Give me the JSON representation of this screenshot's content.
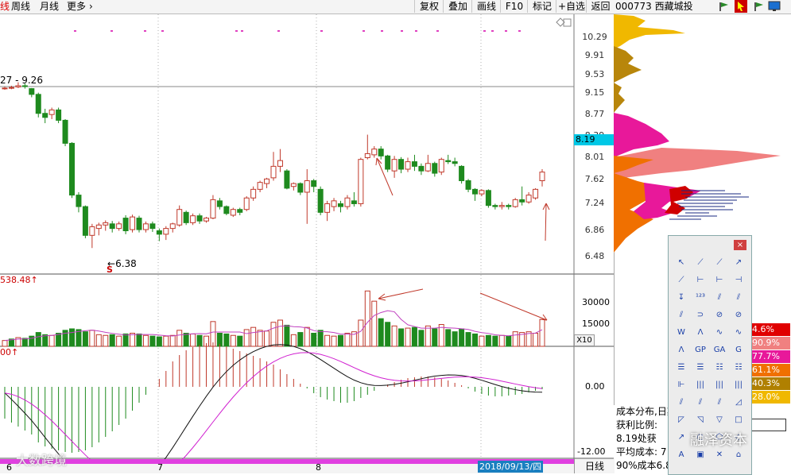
{
  "toolbar": {
    "edge": "线",
    "weekly": "周线",
    "monthly": "月线",
    "more": "更多",
    "more_arrow": "›",
    "buttons": [
      "复权",
      "叠加",
      "画线",
      "F10",
      "标记",
      "+自选",
      "返回"
    ]
  },
  "right_header": {
    "code_name": "000773 西藏城投"
  },
  "price_axis": [
    "10.29",
    "9.91",
    "9.53",
    "9.15",
    "8.77",
    "8.39",
    "8.01",
    "7.62",
    "7.24",
    "6.86",
    "6.48"
  ],
  "current_price": "8.19",
  "range_label": "27 - 9.26",
  "low_label": "6.38",
  "s_marker": "S",
  "volume_label": "538.48",
  "volume_axis": [
    "30000",
    "15000"
  ],
  "volume_unit": "X10",
  "macd_label": "00",
  "macd_axis": [
    "0.00",
    "-12.00"
  ],
  "x_labels": [
    "6",
    "7",
    "8"
  ],
  "date_highlight": "2018/09/13/四",
  "timeframe": "日线",
  "distribution": {
    "title": "成本分布,日期",
    "profit_ratio": "获利比例:",
    "cost_at": "8.19处获",
    "avg_cost": "平均成本: 7",
    "cost90": "90%成本6.8"
  },
  "percent_boxes": [
    {
      "text": "4.6%",
      "color": "#e00000"
    },
    {
      "text": "90.9%",
      "color": "#f08080"
    },
    {
      "text": "77.7%",
      "color": "#e8189a"
    },
    {
      "text": "61.1%",
      "color": "#f07000"
    },
    {
      "text": "40.3%",
      "color": "#b08000"
    },
    {
      "text": "28.0%",
      "color": "#f0b800"
    }
  ],
  "watermarks": {
    "left": "大数跨境",
    "right": "融泽资本"
  },
  "candles": [
    {
      "o": 9.15,
      "c": 9.16,
      "h": 9.18,
      "l": 9.13
    },
    {
      "o": 9.16,
      "c": 9.17,
      "h": 9.2,
      "l": 9.14
    },
    {
      "o": 9.18,
      "c": 9.2,
      "h": 9.26,
      "l": 9.16
    },
    {
      "o": 9.2,
      "c": 9.19,
      "h": 9.24,
      "l": 9.15
    },
    {
      "o": 9.15,
      "c": 9.05,
      "h": 9.16,
      "l": 9.0
    },
    {
      "o": 9.05,
      "c": 8.72,
      "h": 9.08,
      "l": 8.65
    },
    {
      "o": 8.72,
      "c": 8.65,
      "h": 8.8,
      "l": 8.55
    },
    {
      "o": 8.7,
      "c": 8.78,
      "h": 8.82,
      "l": 8.62
    },
    {
      "o": 8.78,
      "c": 8.6,
      "h": 8.82,
      "l": 8.55
    },
    {
      "o": 8.6,
      "c": 8.2,
      "h": 8.62,
      "l": 8.15
    },
    {
      "o": 8.2,
      "c": 7.3,
      "h": 8.22,
      "l": 7.25
    },
    {
      "o": 7.3,
      "c": 7.1,
      "h": 7.35,
      "l": 7.0
    },
    {
      "o": 7.1,
      "c": 6.6,
      "h": 7.12,
      "l": 6.55
    },
    {
      "o": 6.6,
      "c": 6.75,
      "h": 6.8,
      "l": 6.38
    },
    {
      "o": 6.72,
      "c": 6.78,
      "h": 6.82,
      "l": 6.6
    },
    {
      "o": 6.78,
      "c": 6.82,
      "h": 6.86,
      "l": 6.68
    },
    {
      "o": 6.8,
      "c": 6.72,
      "h": 6.85,
      "l": 6.65
    },
    {
      "o": 6.72,
      "c": 6.8,
      "h": 6.84,
      "l": 6.68
    },
    {
      "o": 6.9,
      "c": 6.68,
      "h": 6.95,
      "l": 6.62
    },
    {
      "o": 6.7,
      "c": 6.92,
      "h": 6.96,
      "l": 6.65
    },
    {
      "o": 6.9,
      "c": 6.7,
      "h": 6.94,
      "l": 6.65
    },
    {
      "o": 6.7,
      "c": 6.8,
      "h": 6.84,
      "l": 6.65
    },
    {
      "o": 6.8,
      "c": 6.72,
      "h": 6.84,
      "l": 6.66
    },
    {
      "o": 6.68,
      "c": 6.62,
      "h": 6.72,
      "l": 6.5
    },
    {
      "o": 6.62,
      "c": 6.72,
      "h": 6.76,
      "l": 6.52
    },
    {
      "o": 6.72,
      "c": 6.8,
      "h": 6.82,
      "l": 6.65
    },
    {
      "o": 6.78,
      "c": 7.05,
      "h": 7.12,
      "l": 6.75
    },
    {
      "o": 7.0,
      "c": 6.82,
      "h": 7.03,
      "l": 6.78
    },
    {
      "o": 6.82,
      "c": 6.94,
      "h": 6.98,
      "l": 6.78
    },
    {
      "o": 6.94,
      "c": 6.85,
      "h": 6.98,
      "l": 6.8
    },
    {
      "o": 6.85,
      "c": 6.9,
      "h": 6.92,
      "l": 6.82
    },
    {
      "o": 6.9,
      "c": 7.22,
      "h": 7.3,
      "l": 6.88
    },
    {
      "o": 7.2,
      "c": 7.1,
      "h": 7.25,
      "l": 7.05
    },
    {
      "o": 7.1,
      "c": 6.98,
      "h": 7.12,
      "l": 6.95
    },
    {
      "o": 6.95,
      "c": 7.05,
      "h": 7.08,
      "l": 6.92
    },
    {
      "o": 7.05,
      "c": 7.0,
      "h": 7.08,
      "l": 6.95
    },
    {
      "o": 7.05,
      "c": 7.25,
      "h": 7.28,
      "l": 7.02
    },
    {
      "o": 7.25,
      "c": 7.4,
      "h": 7.45,
      "l": 7.2
    },
    {
      "o": 7.4,
      "c": 7.52,
      "h": 7.55,
      "l": 7.35
    },
    {
      "o": 7.5,
      "c": 7.58,
      "h": 7.6,
      "l": 7.42
    },
    {
      "o": 7.6,
      "c": 7.8,
      "h": 8.05,
      "l": 7.55
    },
    {
      "o": 7.8,
      "c": 7.9,
      "h": 8.1,
      "l": 7.7
    },
    {
      "o": 7.72,
      "c": 7.42,
      "h": 7.75,
      "l": 7.4
    },
    {
      "o": 7.45,
      "c": 7.5,
      "h": 7.52,
      "l": 7.38
    },
    {
      "o": 7.5,
      "c": 7.35,
      "h": 7.52,
      "l": 7.3
    },
    {
      "o": 7.35,
      "c": 7.55,
      "h": 7.75,
      "l": 6.8
    },
    {
      "o": 7.55,
      "c": 7.45,
      "h": 7.58,
      "l": 7.35
    },
    {
      "o": 7.4,
      "c": 7.0,
      "h": 7.45,
      "l": 6.95
    },
    {
      "o": 7.0,
      "c": 7.15,
      "h": 7.2,
      "l": 6.85
    },
    {
      "o": 7.1,
      "c": 7.2,
      "h": 7.25,
      "l": 7.02
    },
    {
      "o": 7.15,
      "c": 7.1,
      "h": 7.2,
      "l": 7.0
    },
    {
      "o": 7.1,
      "c": 7.25,
      "h": 7.3,
      "l": 7.05
    },
    {
      "o": 7.2,
      "c": 7.15,
      "h": 7.35,
      "l": 7.1
    },
    {
      "o": 7.15,
      "c": 7.92,
      "h": 7.95,
      "l": 7.1
    },
    {
      "o": 7.95,
      "c": 8.02,
      "h": 8.35,
      "l": 7.92
    },
    {
      "o": 8.0,
      "c": 8.1,
      "h": 8.15,
      "l": 7.95
    },
    {
      "o": 8.1,
      "c": 7.98,
      "h": 8.15,
      "l": 7.92
    },
    {
      "o": 7.98,
      "c": 7.75,
      "h": 8.0,
      "l": 7.7
    },
    {
      "o": 7.72,
      "c": 7.92,
      "h": 7.98,
      "l": 7.6
    },
    {
      "o": 7.92,
      "c": 7.75,
      "h": 7.96,
      "l": 7.68
    },
    {
      "o": 7.75,
      "c": 7.88,
      "h": 7.95,
      "l": 7.7
    },
    {
      "o": 7.88,
      "c": 7.8,
      "h": 8.0,
      "l": 7.72
    },
    {
      "o": 7.8,
      "c": 7.72,
      "h": 7.85,
      "l": 7.65
    },
    {
      "o": 7.72,
      "c": 7.85,
      "h": 8.0,
      "l": 7.7
    },
    {
      "o": 7.85,
      "c": 7.68,
      "h": 7.88,
      "l": 7.62
    },
    {
      "o": 7.7,
      "c": 7.92,
      "h": 7.95,
      "l": 7.65
    },
    {
      "o": 7.9,
      "c": 7.88,
      "h": 8.0,
      "l": 7.84
    },
    {
      "o": 7.88,
      "c": 7.85,
      "h": 7.95,
      "l": 7.8
    },
    {
      "o": 7.8,
      "c": 7.55,
      "h": 7.82,
      "l": 7.5
    },
    {
      "o": 7.55,
      "c": 7.4,
      "h": 7.58,
      "l": 7.35
    },
    {
      "o": 7.4,
      "c": 7.32,
      "h": 7.42,
      "l": 7.2
    },
    {
      "o": 7.32,
      "c": 7.38,
      "h": 7.4,
      "l": 7.28
    },
    {
      "o": 7.38,
      "c": 7.12,
      "h": 7.4,
      "l": 7.08
    },
    {
      "o": 7.12,
      "c": 7.1,
      "h": 7.15,
      "l": 7.05
    },
    {
      "o": 7.1,
      "c": 7.12,
      "h": 7.18,
      "l": 7.05
    },
    {
      "o": 7.12,
      "c": 7.1,
      "h": 7.15,
      "l": 7.05
    },
    {
      "o": 7.1,
      "c": 7.22,
      "h": 7.25,
      "l": 7.08
    },
    {
      "o": 7.22,
      "c": 7.18,
      "h": 7.45,
      "l": 7.12
    },
    {
      "o": 7.18,
      "c": 7.3,
      "h": 7.35,
      "l": 7.15
    },
    {
      "o": 7.25,
      "c": 7.4,
      "h": 7.42,
      "l": 7.22
    },
    {
      "o": 7.55,
      "c": 7.7,
      "h": 7.75,
      "l": 7.45
    }
  ],
  "volumes": [
    {
      "v": 4000,
      "up": true
    },
    {
      "v": 5000,
      "up": false
    },
    {
      "v": 6000,
      "up": true
    },
    {
      "v": 5500,
      "up": false
    },
    {
      "v": 7000,
      "up": false
    },
    {
      "v": 9500,
      "up": false
    },
    {
      "v": 8000,
      "up": false
    },
    {
      "v": 7500,
      "up": true
    },
    {
      "v": 9000,
      "up": false
    },
    {
      "v": 11000,
      "up": false
    },
    {
      "v": 12000,
      "up": false
    },
    {
      "v": 11500,
      "up": false
    },
    {
      "v": 10000,
      "up": false
    },
    {
      "v": 11000,
      "up": true
    },
    {
      "v": 8000,
      "up": true
    },
    {
      "v": 7500,
      "up": true
    },
    {
      "v": 8000,
      "up": false
    },
    {
      "v": 7000,
      "up": true
    },
    {
      "v": 8500,
      "up": false
    },
    {
      "v": 9000,
      "up": true
    },
    {
      "v": 8500,
      "up": false
    },
    {
      "v": 7500,
      "up": true
    },
    {
      "v": 7000,
      "up": false
    },
    {
      "v": 6500,
      "up": false
    },
    {
      "v": 7000,
      "up": true
    },
    {
      "v": 7500,
      "up": true
    },
    {
      "v": 11000,
      "up": true
    },
    {
      "v": 9000,
      "up": false
    },
    {
      "v": 8500,
      "up": true
    },
    {
      "v": 7500,
      "up": false
    },
    {
      "v": 7000,
      "up": true
    },
    {
      "v": 17000,
      "up": true
    },
    {
      "v": 9000,
      "up": false
    },
    {
      "v": 8500,
      "up": false
    },
    {
      "v": 7500,
      "up": true
    },
    {
      "v": 7000,
      "up": false
    },
    {
      "v": 11500,
      "up": true
    },
    {
      "v": 13000,
      "up": true
    },
    {
      "v": 11000,
      "up": true
    },
    {
      "v": 10500,
      "up": true
    },
    {
      "v": 16500,
      "up": true
    },
    {
      "v": 18000,
      "up": true
    },
    {
      "v": 14500,
      "up": false
    },
    {
      "v": 8000,
      "up": true
    },
    {
      "v": 9500,
      "up": false
    },
    {
      "v": 13000,
      "up": true
    },
    {
      "v": 9000,
      "up": false
    },
    {
      "v": 11000,
      "up": false
    },
    {
      "v": 7500,
      "up": true
    },
    {
      "v": 7000,
      "up": true
    },
    {
      "v": 7500,
      "up": false
    },
    {
      "v": 9000,
      "up": true
    },
    {
      "v": 10000,
      "up": true
    },
    {
      "v": 18000,
      "up": true
    },
    {
      "v": 38000,
      "up": true
    },
    {
      "v": 31000,
      "up": true
    },
    {
      "v": 19000,
      "up": false
    },
    {
      "v": 16500,
      "up": false
    },
    {
      "v": 14000,
      "up": true
    },
    {
      "v": 12000,
      "up": false
    },
    {
      "v": 12500,
      "up": true
    },
    {
      "v": 13000,
      "up": false
    },
    {
      "v": 11000,
      "up": false
    },
    {
      "v": 14000,
      "up": true
    },
    {
      "v": 12000,
      "up": false
    },
    {
      "v": 15000,
      "up": true
    },
    {
      "v": 11500,
      "up": false
    },
    {
      "v": 10000,
      "up": false
    },
    {
      "v": 12000,
      "up": false
    },
    {
      "v": 9500,
      "up": false
    },
    {
      "v": 8500,
      "up": false
    },
    {
      "v": 7000,
      "up": true
    },
    {
      "v": 7500,
      "up": false
    },
    {
      "v": 7000,
      "up": false
    },
    {
      "v": 7500,
      "up": true
    },
    {
      "v": 7000,
      "up": false
    },
    {
      "v": 10000,
      "up": true
    },
    {
      "v": 9500,
      "up": true
    },
    {
      "v": 10000,
      "up": true
    },
    {
      "v": 9000,
      "up": true
    },
    {
      "v": 18500,
      "up": true
    }
  ],
  "macd": [
    -4,
    -4.5,
    -5,
    -5.5,
    -6,
    -7,
    -7.5,
    -7.8,
    -8,
    -8.2,
    -8.3,
    -8.2,
    -8,
    -7.6,
    -7,
    -6.3,
    -5.6,
    -4.8,
    -4,
    -3,
    -2,
    -1,
    0,
    1,
    2,
    3.2,
    4,
    4.6,
    5,
    5.3,
    5.5,
    5.6,
    5.4,
    5.1,
    4.8,
    4.5,
    4.2,
    3.9,
    3.6,
    3.2,
    2.8,
    2.2,
    1.6,
    1,
    0.4,
    -0.2,
    -0.8,
    -1.3,
    -1.6,
    -1.8,
    -2,
    -2,
    -1.8,
    -1.4,
    -1,
    -0.5,
    0,
    0.3,
    0.6,
    0.9,
    1.1,
    1.2,
    1.3,
    1.3,
    1.2,
    1,
    0.8,
    0.5,
    0.2,
    -0.2,
    -0.6,
    -0.9,
    -1.1,
    -1.2,
    -1.2,
    -1.1,
    -1,
    -0.9,
    -0.7,
    -0.5,
    -0.3
  ]
}
